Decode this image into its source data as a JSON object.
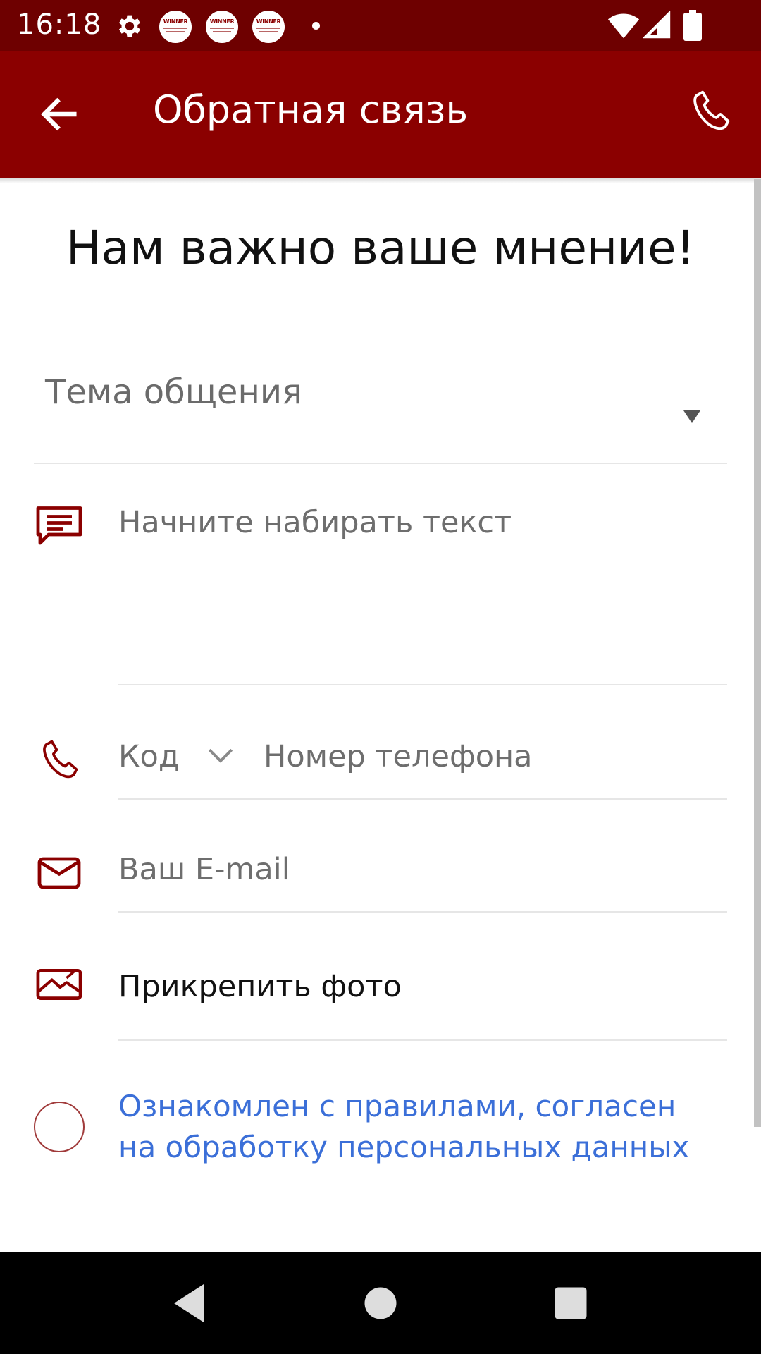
{
  "status_bar": {
    "time": "16:18",
    "notification_badge_text": "WINNER"
  },
  "app_bar": {
    "title": "Обратная связь"
  },
  "heading": "Нам важно ваше мнение!",
  "form": {
    "topic_label": "Тема общения",
    "message_placeholder": "Начните набирать текст",
    "phone_code_placeholder": "Код",
    "phone_number_placeholder": "Номер телефона",
    "email_placeholder": "Ваш E-mail",
    "attach_photo_label": "Прикрепить фото",
    "consent_line1": "Ознакомлен с правилами, согласен",
    "consent_line2": "на обработку персональных данных",
    "consent_checked": false
  },
  "colors": {
    "status_bar": "#6e0000",
    "app_bar": "#8b0000",
    "accent_icon": "#8b0000",
    "link": "#3b6fd8"
  },
  "icons": [
    "gear-icon",
    "back-arrow-icon",
    "phone-icon",
    "message-icon",
    "chevron-down-icon",
    "mail-icon",
    "image-icon",
    "wifi-icon",
    "signal-icon",
    "battery-icon"
  ]
}
